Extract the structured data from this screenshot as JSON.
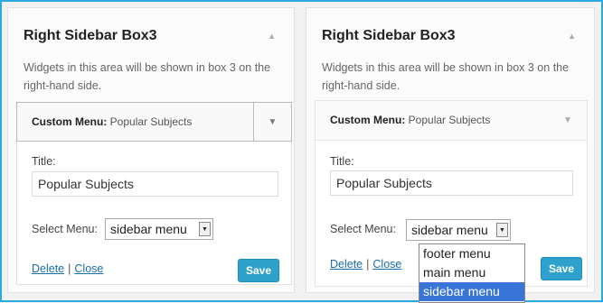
{
  "panels": [
    {
      "title": "Right Sidebar Box3",
      "description": "Widgets in this area will be shown in box 3 on the right-hand side.",
      "widget": {
        "header_label": "Custom Menu:",
        "header_name": "Popular Subjects",
        "title_label": "Title:",
        "title_value": "Popular Subjects",
        "select_label": "Select Menu:",
        "select_value": "sidebar menu",
        "delete_label": "Delete",
        "separator": "|",
        "close_label": "Close",
        "save_label": "Save"
      }
    },
    {
      "title": "Right Sidebar Box3",
      "description": "Widgets in this area will be shown in box 3 on the right-hand side.",
      "widget": {
        "header_label": "Custom Menu:",
        "header_name": "Popular Subjects",
        "title_label": "Title:",
        "title_value": "Popular Subjects",
        "select_label": "Select Menu:",
        "select_value": "sidebar menu",
        "delete_label": "Delete",
        "separator": "|",
        "close_label": "Close",
        "save_label": "Save",
        "dropdown_options": [
          "footer menu",
          "main menu",
          "sidebar menu"
        ],
        "dropdown_selected": "sidebar menu"
      }
    }
  ],
  "colors": {
    "frame_border": "#29a9e0",
    "save_button": "#2ea2cc",
    "link": "#1a6ea8",
    "dropdown_highlight": "#3875d7"
  },
  "icons": {
    "panel_toggle": "triangle-up-icon",
    "widget_toggle": "triangle-down-icon",
    "select_arrow": "triangle-down-icon"
  }
}
